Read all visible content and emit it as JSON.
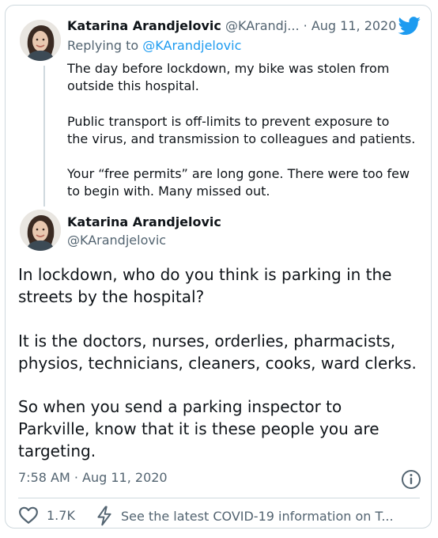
{
  "reply_tweet": {
    "author_name": "Katarina Arandjelovic",
    "author_handle": "@KArandj...",
    "separator": "·",
    "date": "Aug 11, 2020",
    "replying_to_label": "Replying to",
    "replying_to_handle": "@KArandjelovic",
    "paragraphs": [
      "The day before lockdown, my bike was stolen from\noutside this hospital.",
      "Public transport is off-limits to prevent exposure to\nthe virus, and transmission to colleagues and patients.",
      "Your “free permits” are long gone. There were too few\nto begin with. Many missed out."
    ]
  },
  "main_tweet": {
    "author_name": "Katarina Arandjelovic",
    "author_handle": "@KArandjelovic",
    "paragraphs": [
      "In lockdown, who do you think is parking in the\nstreets by the hospital?",
      "It is the doctors, nurses, orderlies, pharmacists,\nphysios, technicians, cleaners, cooks, ward clerks.",
      "So when you send a parking inspector to\nParkville, know that it is these people you are\ntargeting."
    ],
    "timestamp": "7:58 AM · Aug 11, 2020"
  },
  "footer": {
    "likes": "1.7K",
    "covid_notice": "See the latest COVID-19 information on T..."
  },
  "colors": {
    "brand": "#1d9bf0",
    "muted": "#536471",
    "border": "#cfd9de"
  },
  "icons": [
    "twitter-bird-icon",
    "info-icon",
    "heart-icon",
    "lightning-icon"
  ]
}
